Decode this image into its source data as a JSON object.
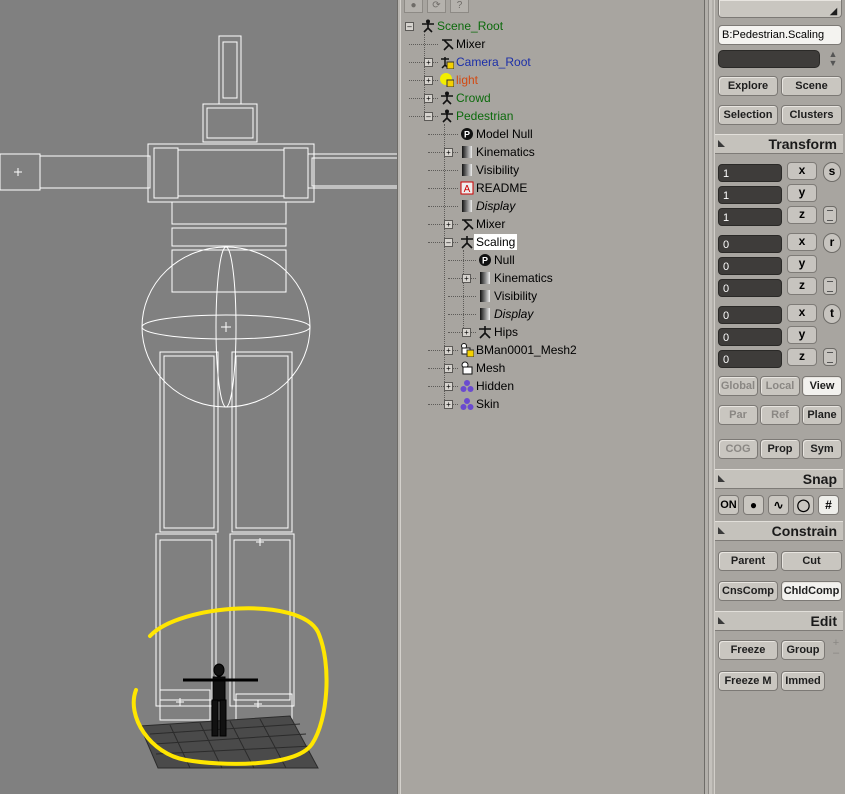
{
  "explorer": {
    "toolbar": [
      "lock-icon",
      "refresh-icon",
      "help-icon"
    ],
    "nodes": [
      {
        "label": "Scene_Root",
        "depth": 0,
        "icon": "null-figure-icon",
        "color": "#0c6a0c",
        "expand": "-"
      },
      {
        "label": "Mixer",
        "depth": 1,
        "icon": "mixer-icon",
        "color": "#000000",
        "expand": ""
      },
      {
        "label": "Camera_Root",
        "depth": 1,
        "icon": "camera-root-icon",
        "color": "#1c2fa8",
        "expand": "+"
      },
      {
        "label": "light",
        "depth": 1,
        "icon": "light-icon",
        "color": "#d24a12",
        "expand": "+"
      },
      {
        "label": "Crowd",
        "depth": 1,
        "icon": "null-figure-icon",
        "color": "#0c6a0c",
        "expand": "+"
      },
      {
        "label": "Pedestrian",
        "depth": 1,
        "icon": "null-figure-icon",
        "color": "#0c6a0c",
        "expand": "-"
      },
      {
        "label": "Model Null",
        "depth": 2,
        "icon": "model-null-icon",
        "color": "#000000",
        "expand": ""
      },
      {
        "label": "Kinematics",
        "depth": 2,
        "icon": "property-icon",
        "color": "#000000",
        "expand": "+"
      },
      {
        "label": "Visibility",
        "depth": 2,
        "icon": "property-icon",
        "color": "#000000",
        "expand": ""
      },
      {
        "label": "README",
        "depth": 2,
        "icon": "annotation-icon",
        "color": "#000000",
        "expand": ""
      },
      {
        "label": "Display",
        "depth": 2,
        "icon": "property-icon",
        "color": "#000000",
        "expand": "",
        "italic": true
      },
      {
        "label": "Mixer",
        "depth": 2,
        "icon": "mixer-icon",
        "color": "#000000",
        "expand": "+"
      },
      {
        "label": "Scaling",
        "depth": 2,
        "icon": "skeleton-icon",
        "color": "#000000",
        "expand": "-",
        "selected": true
      },
      {
        "label": "Null",
        "depth": 3,
        "icon": "model-null-icon",
        "color": "#000000",
        "expand": ""
      },
      {
        "label": "Kinematics",
        "depth": 3,
        "icon": "property-icon",
        "color": "#000000",
        "expand": "+"
      },
      {
        "label": "Visibility",
        "depth": 3,
        "icon": "property-icon",
        "color": "#000000",
        "expand": ""
      },
      {
        "label": "Display",
        "depth": 3,
        "icon": "property-icon",
        "color": "#000000",
        "expand": "",
        "italic": true
      },
      {
        "label": "Hips",
        "depth": 3,
        "icon": "skeleton-icon",
        "color": "#000000",
        "expand": "+"
      },
      {
        "label": "BMan0001_Mesh2",
        "depth": 2,
        "icon": "mesh-model-icon",
        "color": "#000000",
        "expand": "+"
      },
      {
        "label": "Mesh",
        "depth": 2,
        "icon": "mesh-icon",
        "color": "#000000",
        "expand": "+"
      },
      {
        "label": "Hidden",
        "depth": 2,
        "icon": "group-icon",
        "color": "#000000",
        "expand": "+"
      },
      {
        "label": "Skin",
        "depth": 2,
        "icon": "group-icon",
        "color": "#000000",
        "expand": "+"
      }
    ]
  },
  "panel": {
    "selection_name": "B:Pedestrian.Scaling",
    "select_buttons": [
      "Explore",
      "Scene",
      "Selection",
      "Clusters"
    ],
    "transform": {
      "title": "Transform",
      "scale": {
        "mode": "s",
        "values": [
          "1",
          "1",
          "1"
        ]
      },
      "rotate": {
        "mode": "r",
        "values": [
          "0",
          "0",
          "0"
        ]
      },
      "translate": {
        "mode": "t",
        "values": [
          "0",
          "0",
          "0"
        ]
      },
      "axes": [
        "x",
        "y",
        "z"
      ],
      "ref_row1": [
        "Global",
        "Local",
        "View"
      ],
      "ref_row2": [
        "Par",
        "Ref",
        "Plane"
      ],
      "ref_row3": [
        "COG",
        "Prop",
        "Sym"
      ]
    },
    "snap": {
      "title": "Snap",
      "on_label": "ON"
    },
    "constrain": {
      "title": "Constrain",
      "buttons": [
        "Parent",
        "Cut",
        "CnsComp",
        "ChldComp"
      ]
    },
    "edit": {
      "title": "Edit",
      "buttons": [
        "Freeze",
        "Group",
        "Freeze M",
        "Immed"
      ]
    }
  },
  "colors": {
    "annotation_circle": "#ffe600",
    "wireframe": "#ffffff",
    "viewport_bg": "#808080"
  }
}
